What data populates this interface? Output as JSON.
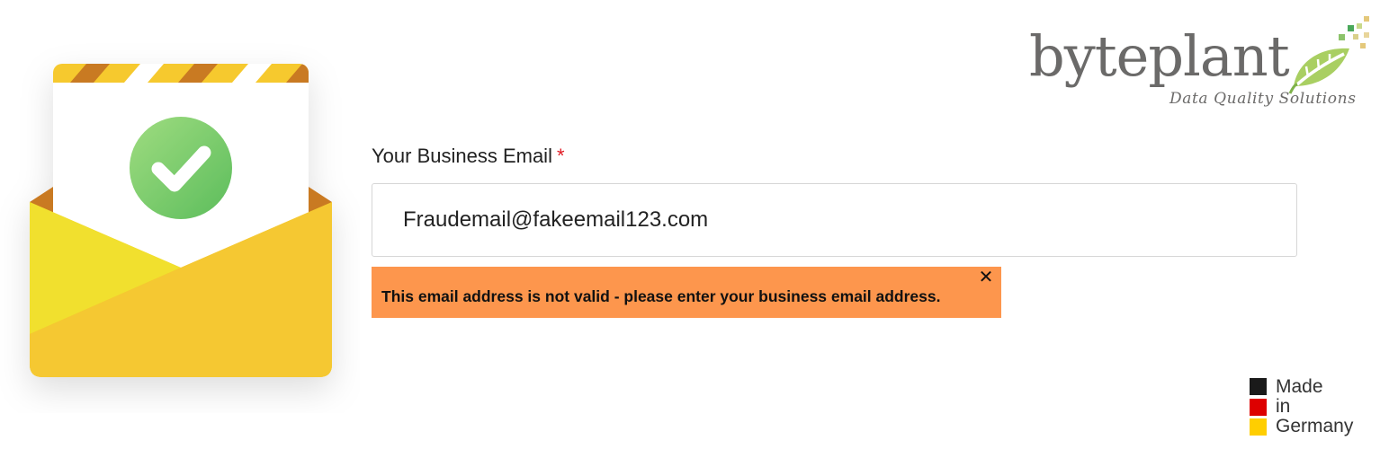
{
  "brand": {
    "name": "byteplant",
    "tagline": "Data Quality Solutions"
  },
  "form": {
    "email_label": "Your Business Email",
    "required_marker": "*",
    "email_value": "Fraudemail@fakeemail123.com"
  },
  "error": {
    "message": "This email address is not valid - please enter your business email address.",
    "close_label": "✕"
  },
  "badge": {
    "lines": [
      "Made",
      "in",
      "Germany"
    ]
  },
  "colors": {
    "error_background": "#fd964d",
    "required_star": "#e01b24",
    "brand_gray": "#6b6a69",
    "check_green": "#6cc46a",
    "envelope_yellow": "#f6c92f",
    "stripe_brown": "#c97a22",
    "flag_black": "#1a1a1a",
    "flag_red": "#dd0000",
    "flag_gold": "#ffce00"
  }
}
